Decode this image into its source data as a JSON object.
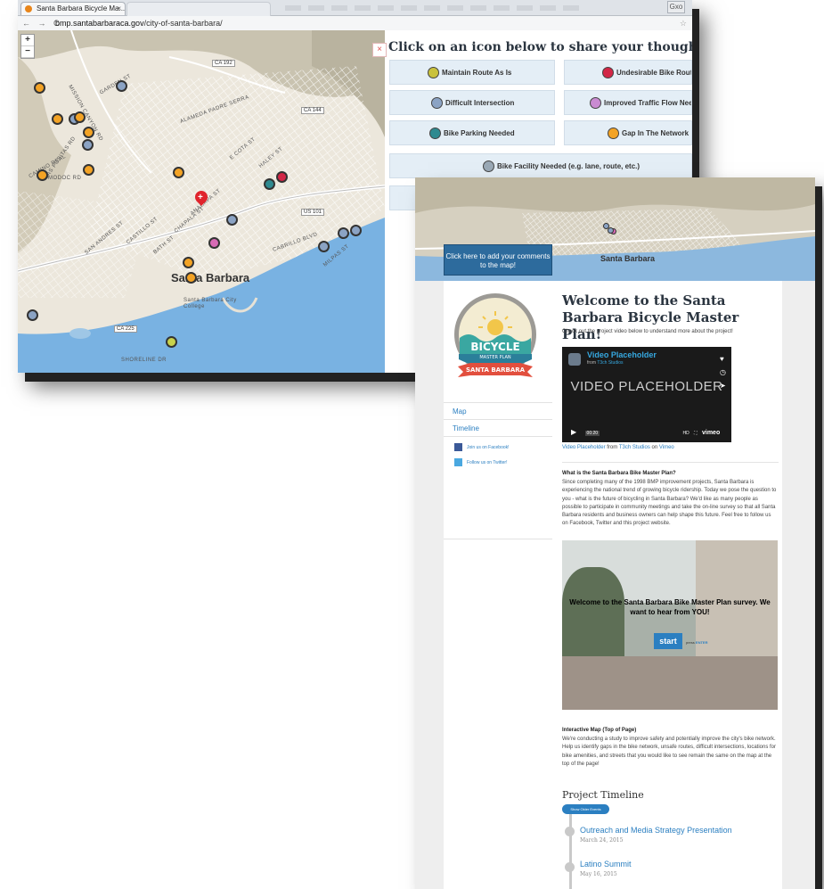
{
  "browser": {
    "tab_title": "Santa Barbara Bicycle Ma...",
    "tab_close": "×",
    "nav_glyphs": "← → C",
    "url_domain": "bmp.santabarbaraca.gov",
    "url_path": "/city-of-santa-barbara/",
    "window_button": "Gxo"
  },
  "map": {
    "zoom_in": "+",
    "zoom_out": "−",
    "city_label": "Santa Barbara",
    "hwy_ca192": "CA 192",
    "hwy_ca144": "CA 144",
    "hwy_us101": "US 101",
    "hwy_ca225": "CA 225",
    "street_labels": [
      "GARDEN ST",
      "ALAMEDA PADRE SERRA",
      "MISSION CANYON RD",
      "LAS POSITAS RD",
      "BATH ST",
      "CASTILLO ST",
      "CHAPALA ST",
      "ANACAPA ST",
      "E COTA ST",
      "CABRILLO BLVD",
      "MODOC RD",
      "SHORELINE DR",
      "CAMINO REAL",
      "SAN ANDRES ST",
      "HALEY ST",
      "MILPAS ST"
    ],
    "college_label": "Santa Barbara City College"
  },
  "panel": {
    "close": "×",
    "title": "Click on an icon below to share your thoughts on th",
    "options": [
      "Maintain Route As Is",
      "Undesirable Bike Route",
      "Difficult Intersection",
      "Improved Traffic Flow Needed",
      "Bike Parking Needed",
      "Gap In The Network",
      "Bike Facility Needed (e.g. lane, route, etc.)"
    ]
  },
  "front": {
    "add_comments": "Click here to add your comments to the map!",
    "banner_city": "Santa Barbara",
    "logo_line1": "BICYCLE",
    "logo_line2": "MASTER PLAN",
    "logo_ribbon": "SANTA BARBARA",
    "nav_map": "Map",
    "nav_timeline": "Timeline",
    "facebook": "Join us on Facebook!",
    "twitter": "Follow us on Twitter!",
    "welcome": "Welcome to the Santa Barbara Bicycle Master Plan!",
    "subtitle": "Check out the project video below to understand more about the project!",
    "video_title": "Video Placeholder",
    "video_from": "from",
    "video_author": "T3ch Studios",
    "video_big": "VIDEO PLACEHOLDER",
    "video_time": "00:20",
    "video_hd": "HD",
    "video_brand": "vimeo",
    "video_caption_a": "Video Placeholder",
    "video_caption_b": " from ",
    "video_caption_c": "T3ch Studios",
    "video_caption_d": " on ",
    "video_caption_e": "Vimeo",
    "q1_head": "What is the Santa Barbara Bike Master Plan?",
    "q1_body": "Since completing many of the 1998 BMP improvement projects, Santa Barbara is experiencing the national trend of growing bicycle ridership. Today we pose the question to you - what is the future of bicycling in Santa Barbara? We'd like as many people as possible to participate in community meetings and take the on-line survey so that all Santa Barbara residents and business owners can help shape this future. Feel free to follow us on Facebook, Twitter and this project website.",
    "survey_text": "Welcome to the Santa Barbara Bike Master Plan survey. We want to hear from YOU!",
    "survey_start": "start",
    "survey_press": "press",
    "survey_enter": "ENTER",
    "q2_head": "Interactive Map (Top of Page)",
    "q2_body": "We're conducting a study to improve safety and potentially improve the city's bike network. Help us identify gaps in the bike network, unsafe routes, difficult intersections, locations for bike amenities, and streets that you would like to see remain the same on the map at the top of the page!",
    "timeline_title": "Project Timeline",
    "older_events": "Show Older Events",
    "events": [
      {
        "title": "Outreach and Media Strategy Presentation",
        "date": "March 24, 2015"
      },
      {
        "title": "Latino Summit",
        "date": "May 16, 2015"
      }
    ]
  },
  "colors": {
    "accent": "#2b7fc1",
    "heading": "#2b3540",
    "button_bg": "#e4eef6",
    "marker_orange": "#f3a325",
    "marker_red": "#e0242c"
  }
}
